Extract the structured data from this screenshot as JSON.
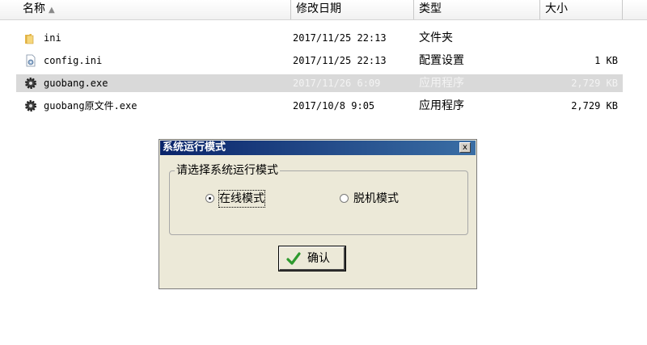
{
  "columns": {
    "name": "名称",
    "date": "修改日期",
    "type": "类型",
    "size": "大小"
  },
  "files": [
    {
      "icon": "folder-icon",
      "name": "ini",
      "date": "2017/11/25 22:13",
      "type": "文件夹",
      "size": ""
    },
    {
      "icon": "ini-file-icon",
      "name": "config.ini",
      "date": "2017/11/25 22:13",
      "type": "配置设置",
      "size": "1 KB"
    },
    {
      "icon": "exe-gear-icon",
      "name": "guobang.exe",
      "date": "2017/11/26 6:09",
      "type": "应用程序",
      "size": "2,729 KB",
      "selected": true
    },
    {
      "icon": "exe-gear-icon",
      "name": "guobang原文件.exe",
      "date": "2017/10/8 9:05",
      "type": "应用程序",
      "size": "2,729 KB"
    }
  ],
  "dialog": {
    "title": "系统运行模式",
    "close": "x",
    "group_label": "请选择系统运行模式",
    "options": [
      {
        "label": "在线模式",
        "checked": true
      },
      {
        "label": "脱机模式",
        "checked": false
      }
    ],
    "ok_label": "确认"
  },
  "colors": {
    "selection": "#d9d9d9",
    "dialog_bg": "#ece9d8",
    "titlebar_start": "#0a246a",
    "titlebar_end": "#3a6ea5",
    "check": "#2e9a2e"
  }
}
